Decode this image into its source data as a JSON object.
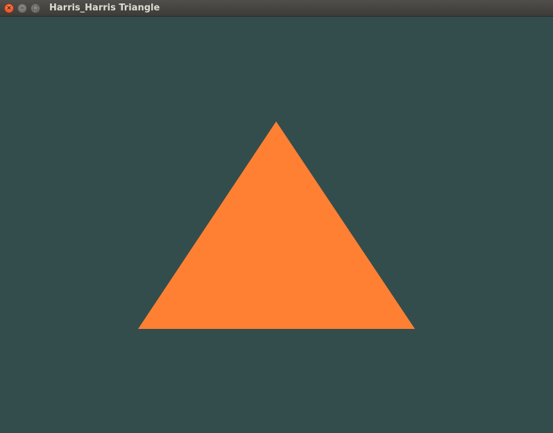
{
  "window": {
    "title": "Harris_Harris Triangle",
    "close_icon": "×",
    "minimize_icon": "–",
    "maximize_icon": "□"
  },
  "scene": {
    "background_color": "#334d4d",
    "triangle_color": "#ff8033"
  }
}
